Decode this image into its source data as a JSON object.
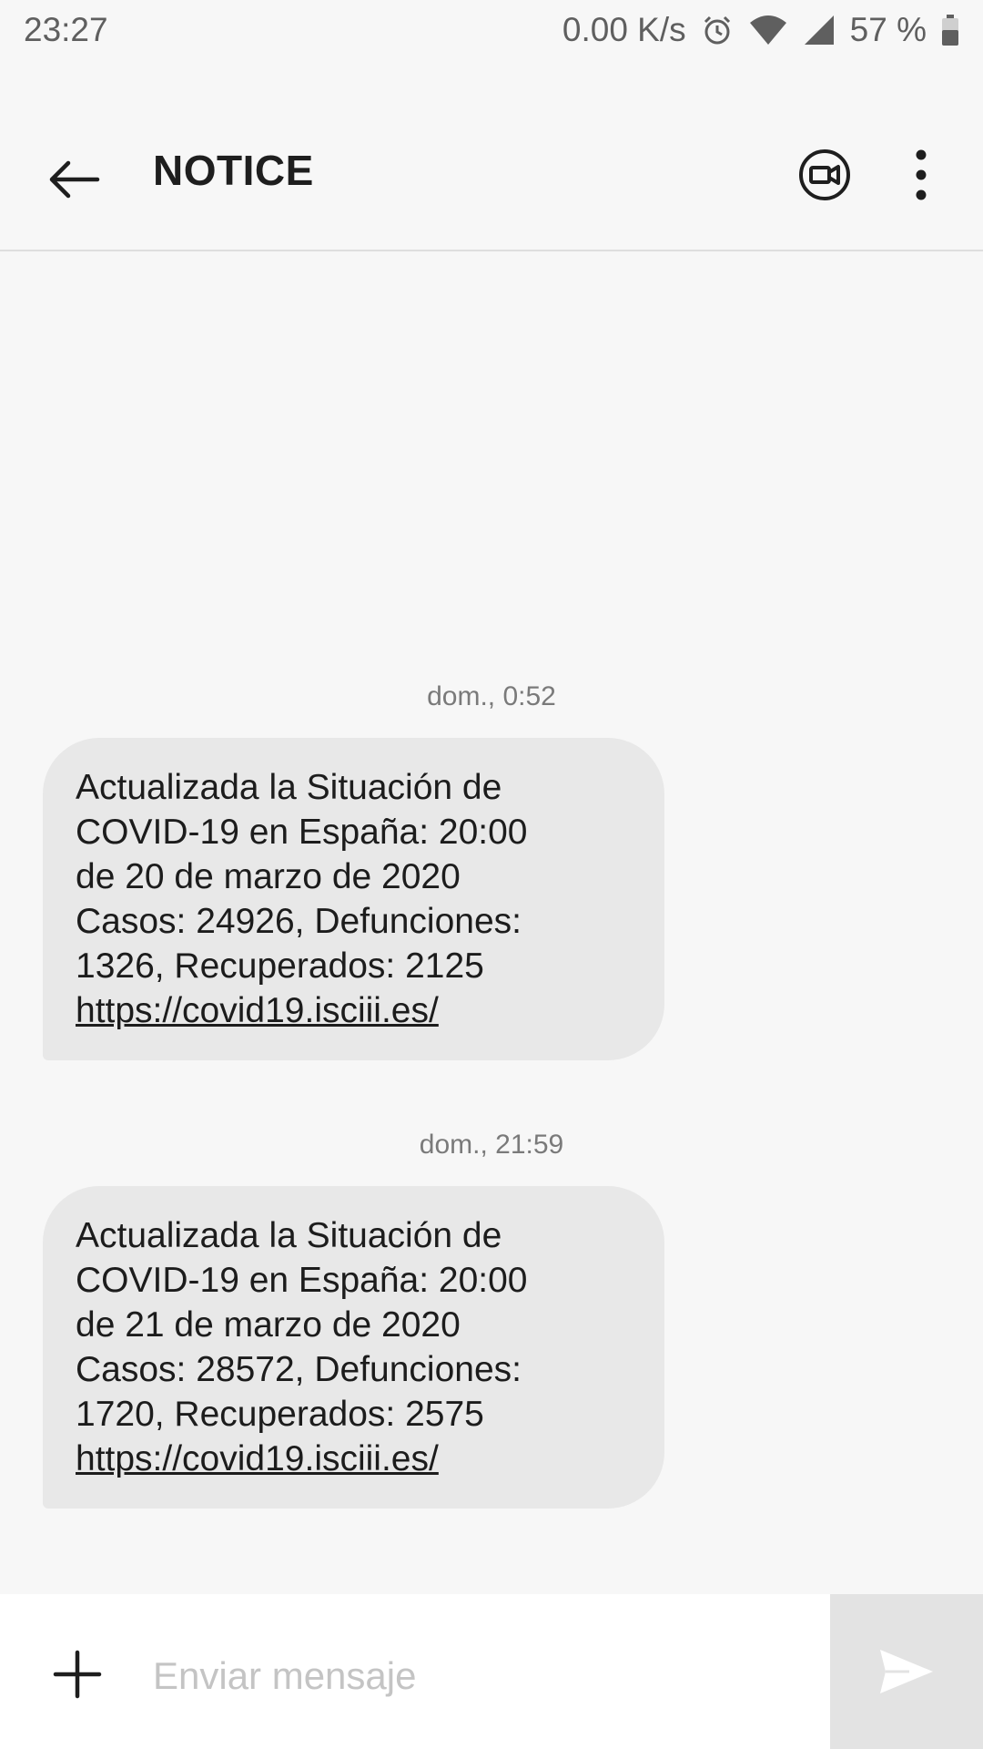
{
  "status_bar": {
    "time": "23:27",
    "network_speed": "0.00 K/s",
    "battery": "57 %",
    "icons": [
      "alarm-icon",
      "wifi-icon",
      "signal-icon",
      "battery-icon"
    ]
  },
  "toolbar": {
    "title": "NOTICE",
    "back_icon": "arrow-left-icon",
    "video_icon": "video-call-icon",
    "more_icon": "more-vertical-icon"
  },
  "messages": [
    {
      "timestamp": "dom., 0:52",
      "lines": [
        "Actualizada la Situación de",
        "COVID-19 en España: 20:00",
        "de 20 de marzo de 2020",
        "Casos: 24926, Defunciones:",
        "1326, Recuperados: 2125"
      ],
      "link": "https://covid19.isciii.es/"
    },
    {
      "timestamp": "dom., 21:59",
      "lines": [
        "Actualizada la Situación de",
        "COVID-19 en España: 20:00",
        "de 21 de marzo de 2020",
        "Casos: 28572, Defunciones:",
        "1720, Recuperados: 2575"
      ],
      "link": "https://covid19.isciii.es/"
    }
  ],
  "composer": {
    "placeholder": "Enviar mensaje",
    "value": "",
    "attach_icon": "plus-icon",
    "send_icon": "send-icon"
  },
  "colors": {
    "background": "#f7f7f7",
    "bubble": "#e8e8e8",
    "send_button": "#e3e3e3",
    "text": "#1c1c1c",
    "muted": "#7a7a7a"
  }
}
